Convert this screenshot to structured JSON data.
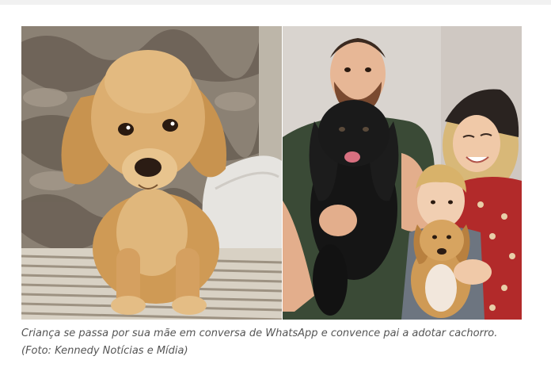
{
  "caption": "Criança se passa por sua mãe em conversa de WhatsApp e convence pai a adotar cachorro. (Foto: Kennedy Notícias e Mídia)",
  "colors": {
    "background": "#ffffff",
    "caption_text": "#555555"
  }
}
